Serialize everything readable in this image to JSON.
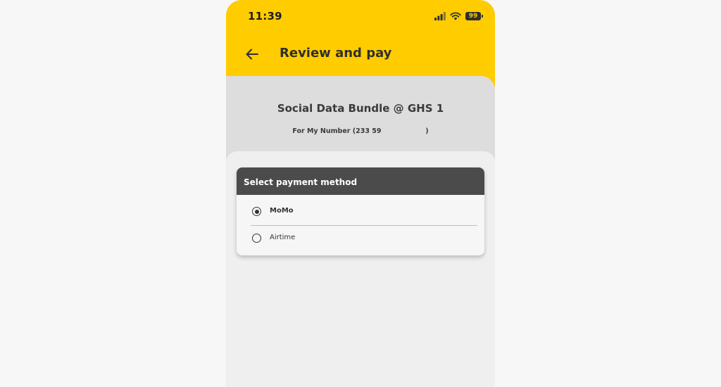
{
  "status_bar": {
    "time": "11:39",
    "battery_level": "99",
    "icons": [
      "signal-icon",
      "wifi-icon",
      "battery-icon"
    ]
  },
  "header": {
    "back_icon": "arrow-left-icon",
    "title": "Review and pay"
  },
  "summary": {
    "title": "Social Data Bundle @ GHS 1",
    "subtitle": "For My Number (233 59                   )"
  },
  "payment": {
    "header": "Select payment method",
    "options": [
      {
        "label": "MoMo",
        "selected": true
      },
      {
        "label": "Airtime",
        "selected": false
      }
    ]
  },
  "colors": {
    "brand_yellow": "#ffcc00",
    "card_header": "#4b4b4b",
    "background": "#eeeeee"
  }
}
